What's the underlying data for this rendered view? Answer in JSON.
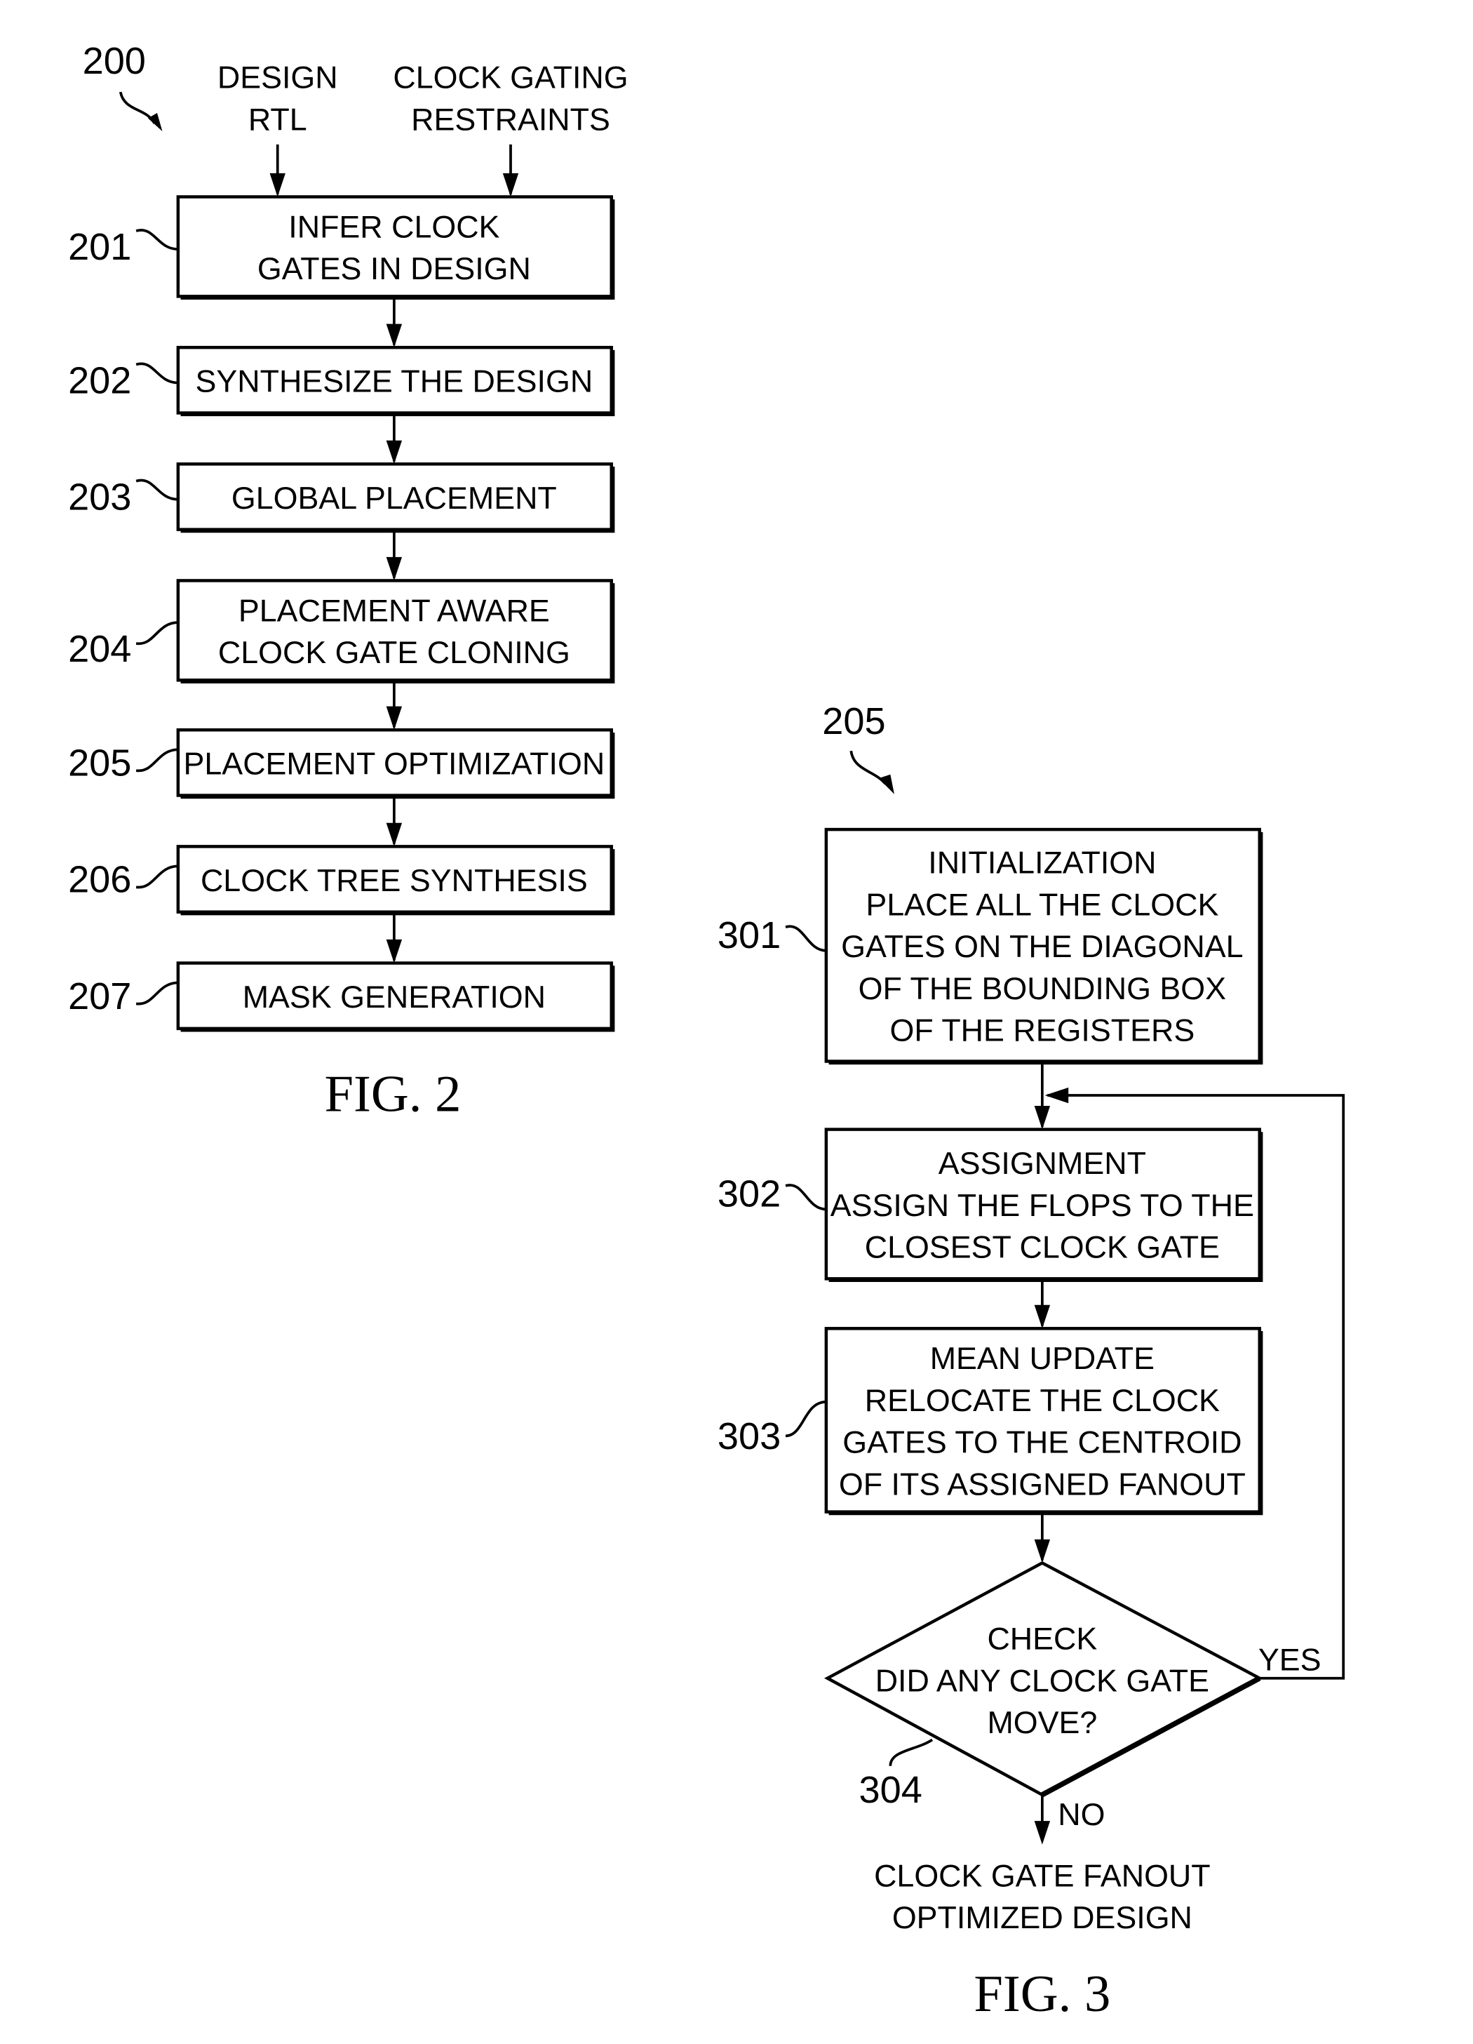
{
  "fig2": {
    "ref": "200",
    "caption": "FIG. 2",
    "inputs": [
      {
        "lines": [
          "DESIGN",
          "RTL"
        ]
      },
      {
        "lines": [
          "CLOCK GATING",
          "RESTRAINTS"
        ]
      }
    ],
    "steps": [
      {
        "ref": "201",
        "lines": [
          "INFER CLOCK",
          "GATES IN DESIGN"
        ]
      },
      {
        "ref": "202",
        "lines": [
          "SYNTHESIZE THE DESIGN"
        ]
      },
      {
        "ref": "203",
        "lines": [
          "GLOBAL PLACEMENT"
        ]
      },
      {
        "ref": "204",
        "lines": [
          "PLACEMENT AWARE",
          "CLOCK GATE CLONING"
        ]
      },
      {
        "ref": "205",
        "lines": [
          "PLACEMENT OPTIMIZATION"
        ]
      },
      {
        "ref": "206",
        "lines": [
          "CLOCK TREE SYNTHESIS"
        ]
      },
      {
        "ref": "207",
        "lines": [
          "MASK GENERATION"
        ]
      }
    ]
  },
  "fig3": {
    "ref": "205",
    "caption": "FIG. 3",
    "steps": [
      {
        "ref": "301",
        "lines": [
          "INITIALIZATION",
          "PLACE ALL THE CLOCK",
          "GATES ON THE DIAGONAL",
          "OF THE BOUNDING BOX",
          "OF THE REGISTERS"
        ]
      },
      {
        "ref": "302",
        "lines": [
          "ASSIGNMENT",
          "ASSIGN THE FLOPS TO THE",
          "CLOSEST CLOCK GATE"
        ]
      },
      {
        "ref": "303",
        "lines": [
          "MEAN UPDATE",
          "RELOCATE THE CLOCK",
          "GATES TO THE CENTROID",
          "OF ITS ASSIGNED FANOUT"
        ]
      }
    ],
    "decision": {
      "ref": "304",
      "lines": [
        "CHECK",
        "DID ANY CLOCK GATE",
        "MOVE?"
      ],
      "yes_label": "YES",
      "no_label": "NO"
    },
    "output": {
      "lines": [
        "CLOCK GATE FANOUT",
        "OPTIMIZED DESIGN"
      ]
    }
  }
}
